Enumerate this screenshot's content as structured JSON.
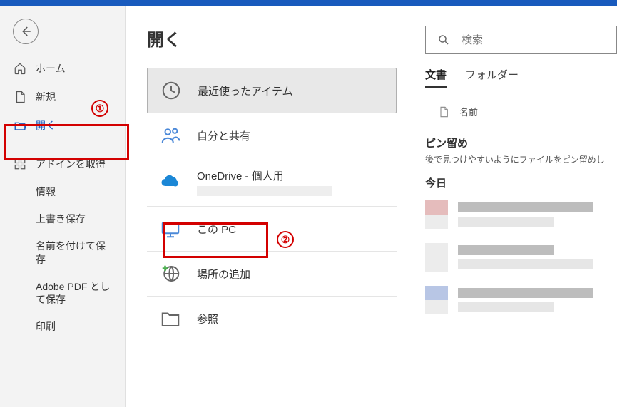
{
  "sidebar": {
    "home": "ホーム",
    "new": "新規",
    "open": "開く",
    "get_addins": "アドインを取得",
    "info": "情報",
    "save": "上書き保存",
    "save_as": "名前を付けて保存",
    "save_adobe": "Adobe PDF として保存",
    "print": "印刷"
  },
  "annot": {
    "badge1": "①",
    "badge2": "②"
  },
  "page_title": "開く",
  "locations": {
    "recent": "最近使ったアイテム",
    "shared": "自分と共有",
    "onedrive": "OneDrive - 個人用",
    "this_pc": "この PC",
    "add_place": "場所の追加",
    "browse": "参照"
  },
  "search": {
    "placeholder": "検索"
  },
  "tabs": {
    "documents": "文書",
    "folders": "フォルダー"
  },
  "columns": {
    "name": "名前"
  },
  "sections": {
    "pinned_title": "ピン留め",
    "pinned_note": "後で見つけやすいようにファイルをピン留めし",
    "today_title": "今日"
  }
}
